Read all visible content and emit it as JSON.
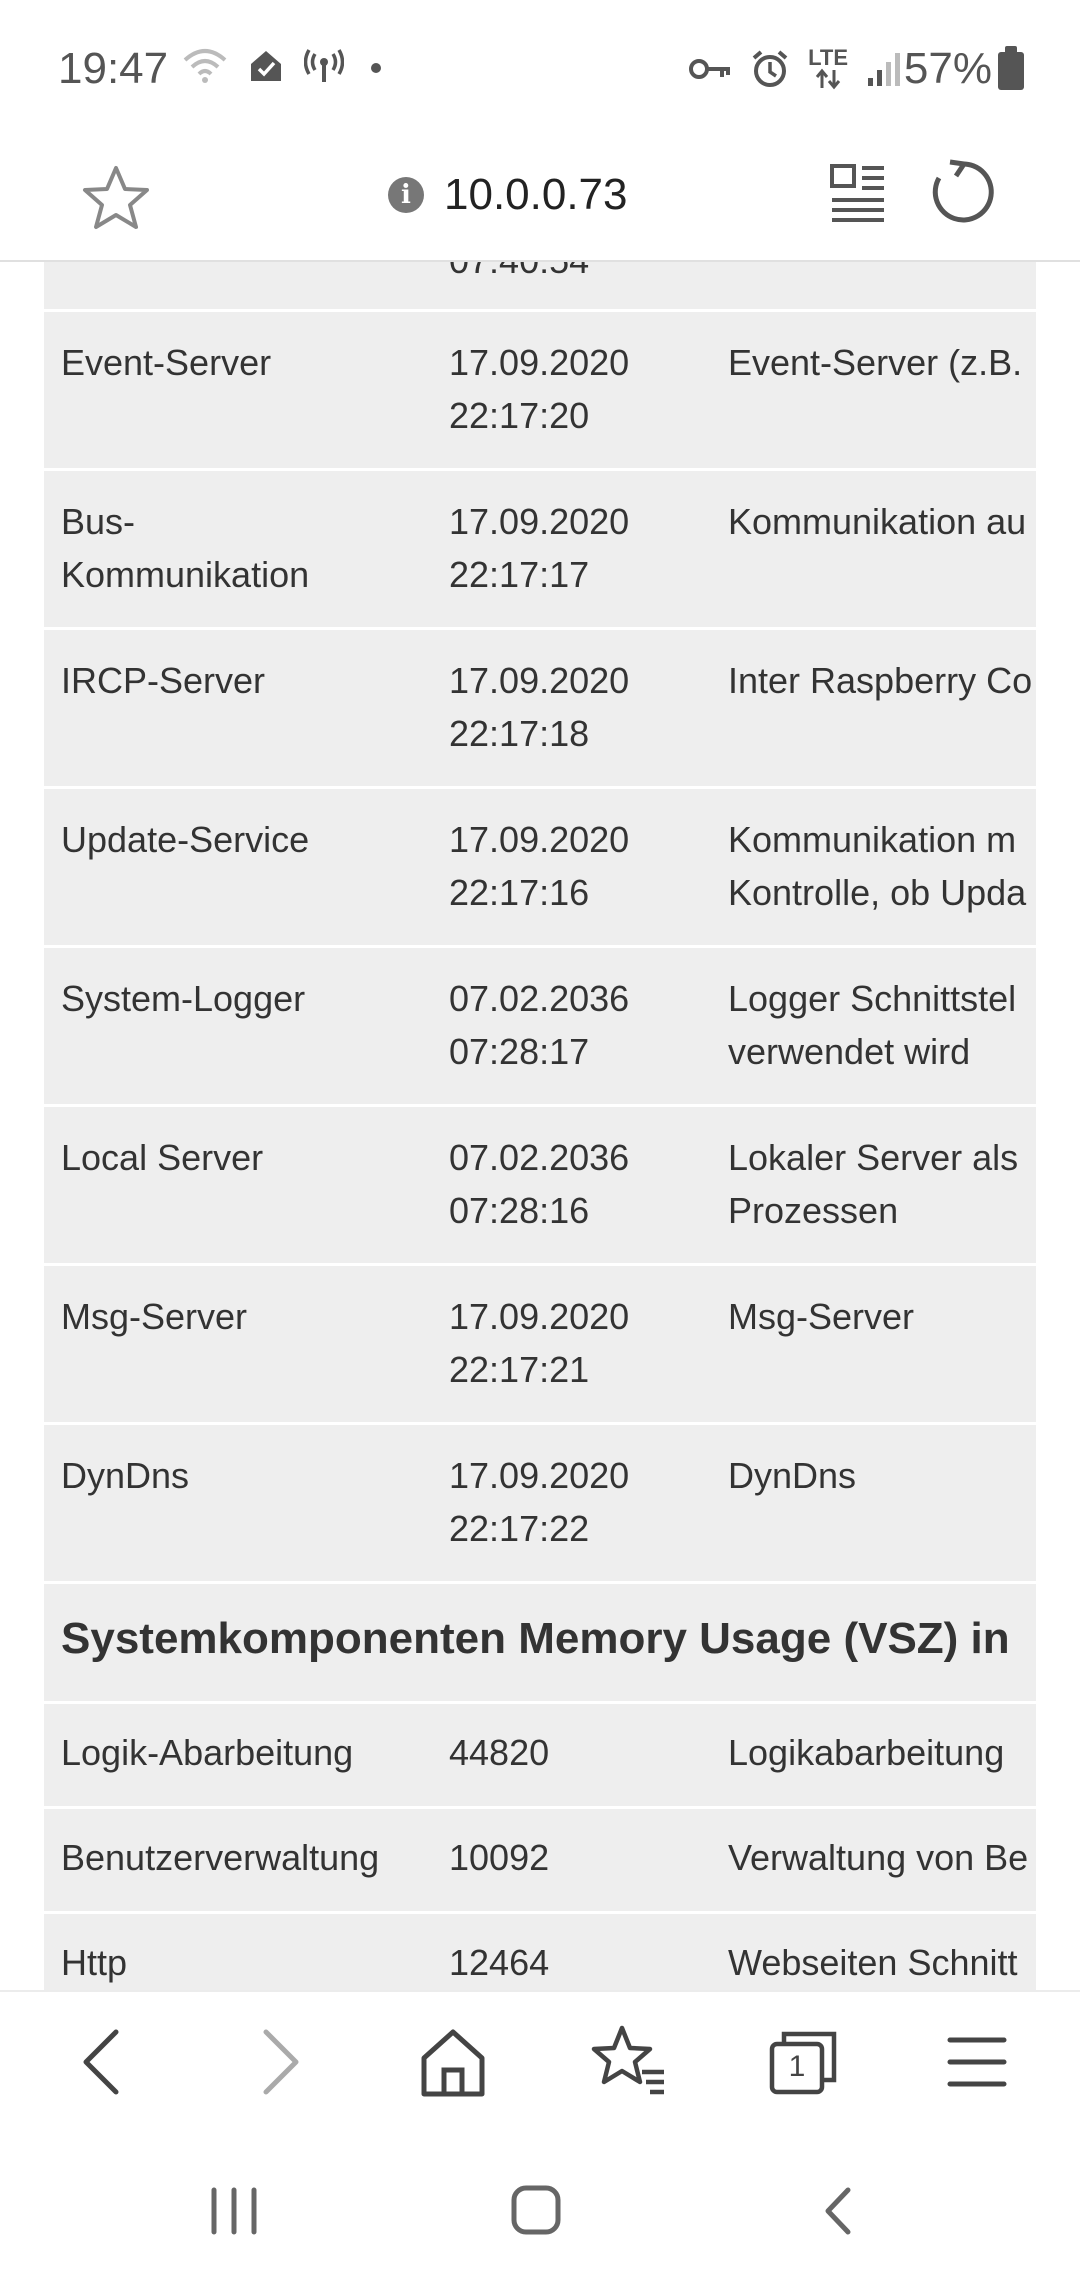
{
  "status_bar": {
    "time": "19:47",
    "lte_label": "LTE",
    "battery": "57%"
  },
  "browser": {
    "url": "10.0.0.73",
    "info_glyph": "i",
    "tab_count": "1"
  },
  "table": {
    "partial_top_row": {
      "col2": "07:40:54"
    },
    "rows": [
      {
        "name": "Event-Server",
        "date": "17.09.2020",
        "time": "22:17:20",
        "desc1": "Event-Server (z.B.",
        "desc2": ""
      },
      {
        "name": "Bus-",
        "name2": "Kommunikation",
        "date": "17.09.2020",
        "time": "22:17:17",
        "desc1": "Kommunikation au",
        "desc2": ""
      },
      {
        "name": "IRCP-Server",
        "date": "17.09.2020",
        "time": "22:17:18",
        "desc1": "Inter Raspberry Co",
        "desc2": ""
      },
      {
        "name": "Update-Service",
        "date": "17.09.2020",
        "time": "22:17:16",
        "desc1": "Kommunikation m",
        "desc2": "Kontrolle, ob Upda"
      },
      {
        "name": "System-Logger",
        "date": "07.02.2036",
        "time": "07:28:17",
        "desc1": "Logger Schnittstel",
        "desc2": "verwendet wird"
      },
      {
        "name": "Local Server",
        "date": "07.02.2036",
        "time": "07:28:16",
        "desc1": "Lokaler Server als",
        "desc2": "Prozessen"
      },
      {
        "name": "Msg-Server",
        "date": "17.09.2020",
        "time": "22:17:21",
        "desc1": "Msg-Server",
        "desc2": ""
      },
      {
        "name": "DynDns",
        "date": "17.09.2020",
        "time": "22:17:22",
        "desc1": "DynDns",
        "desc2": ""
      }
    ],
    "section_title": "Systemkomponenten Memory Usage (VSZ) in",
    "memory_rows": [
      {
        "name": "Logik-Abarbeitung",
        "value": "44820",
        "desc": "Logikabarbeitung"
      },
      {
        "name": "Benutzerverwaltung",
        "value": "10092",
        "desc": "Verwaltung von Be"
      },
      {
        "name": "Http",
        "value": "12464",
        "desc": "Webseiten Schnitt"
      }
    ]
  },
  "colors": {
    "table_bg": "#eeeeee",
    "row_divider": "#ffffff",
    "text": "#333333",
    "icon": "#555555"
  }
}
